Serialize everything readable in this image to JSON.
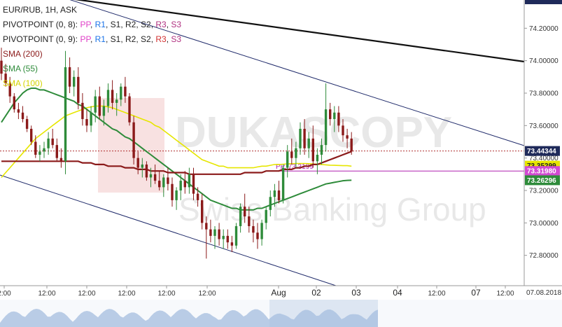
{
  "instrument": {
    "title": "EUR/RUB, 1H, ASK"
  },
  "legend": [
    {
      "id": "pivot8",
      "prefix": "PIVOTPOINT (0, 8): ",
      "tokens": [
        {
          "t": "PP",
          "c": "#e040c8"
        },
        {
          "t": ", ",
          "c": "#222"
        },
        {
          "t": "R1",
          "c": "#1a73e8"
        },
        {
          "t": ", ",
          "c": "#222"
        },
        {
          "t": "S1",
          "c": "#222"
        },
        {
          "t": ", ",
          "c": "#222"
        },
        {
          "t": "R2",
          "c": "#222"
        },
        {
          "t": ", ",
          "c": "#222"
        },
        {
          "t": "S2",
          "c": "#222"
        },
        {
          "t": ", ",
          "c": "#222"
        },
        {
          "t": "R3",
          "c": "#b03080"
        },
        {
          "t": ", ",
          "c": "#222"
        },
        {
          "t": "S3",
          "c": "#b03080"
        }
      ]
    },
    {
      "id": "pivot9",
      "prefix": "PIVOTPOINT (0, 9): ",
      "tokens": [
        {
          "t": "PP",
          "c": "#e040c8"
        },
        {
          "t": ", ",
          "c": "#222"
        },
        {
          "t": "R1",
          "c": "#1a73e8"
        },
        {
          "t": ", ",
          "c": "#222"
        },
        {
          "t": "S1",
          "c": "#222"
        },
        {
          "t": ", ",
          "c": "#222"
        },
        {
          "t": "R2",
          "c": "#222"
        },
        {
          "t": ", ",
          "c": "#222"
        },
        {
          "t": "S2",
          "c": "#222"
        },
        {
          "t": ", ",
          "c": "#222"
        },
        {
          "t": "R3",
          "c": "#d23030"
        },
        {
          "t": ", ",
          "c": "#222"
        },
        {
          "t": "S3",
          "c": "#b03080"
        }
      ]
    },
    {
      "id": "sma200",
      "text": "SMA (200)",
      "color": "#8b1a1a"
    },
    {
      "id": "sma55",
      "text": "SMA (55)",
      "color": "#2e8b3a"
    },
    {
      "id": "sma100",
      "text": "SMA (100)",
      "color": "#d4d400"
    }
  ],
  "watermark": {
    "line1": "DUKASCOPY",
    "line2": "Swiss Banking Group"
  },
  "pivot_label": "PP, 73.3199",
  "date_stamp": "07.08.2018",
  "x_axis": [
    {
      "text": "2:00",
      "big": false
    },
    {
      "text": "12:00",
      "big": false
    },
    {
      "text": "12:00",
      "big": false
    },
    {
      "text": "12:00",
      "big": false
    },
    {
      "text": "12:00",
      "big": false
    },
    {
      "text": "12:00",
      "big": false
    },
    {
      "text": "Aug",
      "big": true
    },
    {
      "text": "02",
      "big": true
    },
    {
      "text": "03",
      "big": true
    },
    {
      "text": "04",
      "big": true
    },
    {
      "text": "12:00",
      "big": false
    },
    {
      "text": "07",
      "big": true
    },
    {
      "text": "12:00",
      "big": false
    }
  ],
  "price_tags": [
    {
      "value": 73.44344,
      "text": "73.44344",
      "bg": "#1f2a5a",
      "fg": "#ffffff"
    },
    {
      "value": 73.35299,
      "text": "73.35299",
      "bg": "#e6e600",
      "fg": "#222222"
    },
    {
      "value": 73.3198,
      "text": "73.31980",
      "bg": "#d24ad2",
      "fg": "#ffffff"
    },
    {
      "value": 73.26296,
      "text": "73.26296",
      "bg": "#2e8b3a",
      "fg": "#ffffff"
    }
  ],
  "colors": {
    "up": "#2e8b3a",
    "down": "#8b1a1a",
    "channel": "#1f2a6a",
    "trend": "#111111",
    "sma200": "#8b1a1a",
    "sma55": "#2e8b3a",
    "sma100": "#e6e600",
    "pivot": "#b020b0",
    "lastline": "#b03030"
  },
  "chart_data": {
    "type": "candlestick",
    "title": "EUR/RUB, 1H, ASK",
    "y_ticks": [
      72.8,
      73.0,
      73.2,
      73.4,
      73.6,
      73.8,
      74.0,
      74.2
    ],
    "ylim": [
      72.65,
      74.36
    ],
    "grid": false,
    "candles": [
      [
        74.0,
        74.08,
        73.88,
        73.92
      ],
      [
        73.92,
        73.98,
        73.84,
        73.86
      ],
      [
        73.86,
        73.9,
        73.74,
        73.78
      ],
      [
        73.78,
        73.8,
        73.68,
        73.7
      ],
      [
        73.7,
        73.74,
        73.64,
        73.68
      ],
      [
        73.68,
        73.72,
        73.62,
        73.64
      ],
      [
        73.64,
        73.66,
        73.56,
        73.58
      ],
      [
        73.58,
        73.6,
        73.48,
        73.5
      ],
      [
        73.5,
        73.54,
        73.4,
        73.42
      ],
      [
        73.42,
        73.48,
        73.38,
        73.44
      ],
      [
        73.44,
        73.5,
        73.4,
        73.46
      ],
      [
        73.46,
        73.56,
        73.42,
        73.52
      ],
      [
        73.52,
        73.58,
        73.46,
        73.48
      ],
      [
        73.48,
        73.52,
        73.38,
        73.4
      ],
      [
        73.4,
        73.46,
        73.34,
        73.38
      ],
      [
        73.38,
        74.06,
        73.3,
        73.96
      ],
      [
        73.96,
        74.02,
        73.8,
        73.84
      ],
      [
        73.84,
        73.94,
        73.78,
        73.9
      ],
      [
        73.9,
        73.96,
        73.7,
        73.74
      ],
      [
        73.74,
        73.8,
        73.6,
        73.64
      ],
      [
        73.64,
        73.7,
        73.56,
        73.6
      ],
      [
        73.6,
        73.72,
        73.56,
        73.68
      ],
      [
        73.68,
        73.82,
        73.62,
        73.78
      ],
      [
        73.78,
        73.84,
        73.64,
        73.66
      ],
      [
        73.66,
        73.76,
        73.6,
        73.72
      ],
      [
        73.72,
        73.86,
        73.68,
        73.82
      ],
      [
        73.82,
        73.88,
        73.7,
        73.74
      ],
      [
        73.74,
        73.8,
        73.66,
        73.76
      ],
      [
        73.76,
        73.86,
        73.72,
        73.84
      ],
      [
        73.84,
        73.9,
        73.74,
        73.78
      ],
      [
        73.78,
        73.8,
        73.6,
        73.62
      ],
      [
        73.62,
        73.66,
        73.36,
        73.4
      ],
      [
        73.4,
        73.44,
        73.3,
        73.34
      ],
      [
        73.34,
        73.4,
        73.28,
        73.36
      ],
      [
        73.36,
        73.38,
        73.26,
        73.28
      ],
      [
        73.28,
        73.34,
        73.22,
        73.3
      ],
      [
        73.3,
        73.36,
        73.24,
        73.26
      ],
      [
        73.26,
        73.32,
        73.2,
        73.22
      ],
      [
        73.22,
        73.3,
        73.16,
        73.28
      ],
      [
        73.28,
        73.34,
        73.2,
        73.24
      ],
      [
        73.24,
        73.28,
        73.1,
        73.14
      ],
      [
        73.14,
        73.22,
        73.08,
        73.2
      ],
      [
        73.2,
        73.3,
        73.14,
        73.26
      ],
      [
        73.26,
        73.32,
        73.18,
        73.22
      ],
      [
        73.22,
        73.34,
        73.18,
        73.3
      ],
      [
        73.3,
        73.34,
        73.14,
        73.18
      ],
      [
        73.18,
        73.22,
        73.1,
        73.14
      ],
      [
        73.14,
        73.18,
        72.96,
        73.0
      ],
      [
        73.0,
        73.04,
        72.78,
        72.96
      ],
      [
        72.96,
        73.02,
        72.88,
        72.92
      ],
      [
        72.92,
        72.98,
        72.84,
        72.96
      ],
      [
        72.96,
        73.0,
        72.86,
        72.9
      ],
      [
        72.9,
        72.96,
        72.84,
        72.92
      ],
      [
        72.92,
        72.96,
        72.84,
        72.88
      ],
      [
        72.88,
        72.92,
        72.82,
        72.86
      ],
      [
        72.86,
        73.0,
        72.84,
        72.98
      ],
      [
        72.98,
        73.12,
        72.94,
        73.1
      ],
      [
        73.1,
        73.18,
        73.0,
        73.04
      ],
      [
        73.04,
        73.1,
        72.94,
        72.98
      ],
      [
        72.98,
        73.02,
        72.88,
        72.94
      ],
      [
        72.94,
        73.0,
        72.84,
        72.9
      ],
      [
        72.9,
        73.02,
        72.86,
        73.0
      ],
      [
        73.0,
        73.1,
        72.96,
        73.08
      ],
      [
        73.08,
        73.2,
        73.04,
        73.16
      ],
      [
        73.16,
        73.24,
        73.1,
        73.2
      ],
      [
        73.2,
        73.26,
        73.12,
        73.14
      ],
      [
        73.14,
        73.36,
        73.12,
        73.34
      ],
      [
        73.34,
        73.48,
        73.28,
        73.44
      ],
      [
        73.44,
        73.52,
        73.36,
        73.4
      ],
      [
        73.4,
        73.5,
        73.34,
        73.46
      ],
      [
        73.46,
        73.62,
        73.42,
        73.58
      ],
      [
        73.58,
        73.64,
        73.42,
        73.46
      ],
      [
        73.46,
        73.56,
        73.4,
        73.52
      ],
      [
        73.52,
        73.6,
        73.34,
        73.38
      ],
      [
        73.38,
        73.46,
        73.3,
        73.42
      ],
      [
        73.42,
        73.52,
        73.36,
        73.48
      ],
      [
        73.48,
        73.86,
        73.44,
        73.7
      ],
      [
        73.7,
        73.74,
        73.6,
        73.64
      ],
      [
        73.64,
        73.72,
        73.56,
        73.68
      ],
      [
        73.68,
        73.72,
        73.56,
        73.6
      ],
      [
        73.6,
        73.64,
        73.5,
        73.54
      ],
      [
        73.54,
        73.58,
        73.46,
        73.52
      ],
      [
        73.52,
        73.56,
        73.42,
        73.44
      ]
    ],
    "sma200": [
      73.38,
      73.38,
      73.38,
      73.38,
      73.38,
      73.38,
      73.38,
      73.38,
      73.38,
      73.38,
      73.38,
      73.38,
      73.38,
      73.38,
      73.38,
      73.38,
      73.38,
      73.38,
      73.38,
      73.37,
      73.37,
      73.37,
      73.36,
      73.36,
      73.36,
      73.35,
      73.35,
      73.35,
      73.35,
      73.34,
      73.34,
      73.34,
      73.33,
      73.33,
      73.33,
      73.32,
      73.32,
      73.32,
      73.32,
      73.31,
      73.31,
      73.31,
      73.31,
      73.31,
      73.3,
      73.3,
      73.3,
      73.3,
      73.3,
      73.3,
      73.3,
      73.3,
      73.3,
      73.3,
      73.3,
      73.3,
      73.3,
      73.31,
      73.31,
      73.31,
      73.31,
      73.31,
      73.32,
      73.32,
      73.32,
      73.32,
      73.33,
      73.33,
      73.33,
      73.34,
      73.34,
      73.35,
      73.35,
      73.36,
      73.36,
      73.37,
      73.38,
      73.39,
      73.4,
      73.41,
      73.42,
      73.43,
      73.44
    ],
    "sma55": [
      73.62,
      73.66,
      73.7,
      73.74,
      73.77,
      73.8,
      73.82,
      73.83,
      73.83,
      73.82,
      73.82,
      73.81,
      73.8,
      73.79,
      73.78,
      73.77,
      73.76,
      73.75,
      73.73,
      73.72,
      73.7,
      73.68,
      73.66,
      73.64,
      73.62,
      73.6,
      73.58,
      73.57,
      73.55,
      73.53,
      73.52,
      73.5,
      73.48,
      73.46,
      73.44,
      73.42,
      73.4,
      73.38,
      73.36,
      73.34,
      73.32,
      73.3,
      73.28,
      73.26,
      73.24,
      73.22,
      73.2,
      73.18,
      73.16,
      73.14,
      73.13,
      73.12,
      73.11,
      73.1,
      73.09,
      73.09,
      73.08,
      73.08,
      73.08,
      73.08,
      73.09,
      73.09,
      73.1,
      73.11,
      73.12,
      73.13,
      73.14,
      73.15,
      73.16,
      73.17,
      73.18,
      73.19,
      73.2,
      73.21,
      73.22,
      73.23,
      73.24,
      73.245,
      73.25,
      73.255,
      73.26,
      73.262,
      73.263
    ],
    "sma100": [
      73.28,
      73.31,
      73.34,
      73.37,
      73.4,
      73.43,
      73.46,
      73.49,
      73.52,
      73.54,
      73.56,
      73.58,
      73.6,
      73.62,
      73.64,
      73.66,
      73.67,
      73.68,
      73.69,
      73.7,
      73.71,
      73.715,
      73.72,
      73.72,
      73.72,
      73.715,
      73.71,
      73.7,
      73.69,
      73.68,
      73.67,
      73.66,
      73.65,
      73.64,
      73.63,
      73.62,
      73.6,
      73.59,
      73.57,
      73.55,
      73.53,
      73.51,
      73.49,
      73.47,
      73.45,
      73.43,
      73.41,
      73.39,
      73.38,
      73.37,
      73.36,
      73.35,
      73.35,
      73.34,
      73.34,
      73.34,
      73.34,
      73.34,
      73.34,
      73.34,
      73.345,
      73.35,
      73.35,
      73.355,
      73.36,
      73.36,
      73.362,
      73.364,
      73.365,
      73.366,
      73.366,
      73.366,
      73.365,
      73.364,
      73.362,
      73.36,
      73.358,
      73.356,
      73.355,
      73.354,
      73.353,
      73.353,
      73.35
    ],
    "pivot_pp": 73.3199,
    "last_price": 73.44344
  }
}
